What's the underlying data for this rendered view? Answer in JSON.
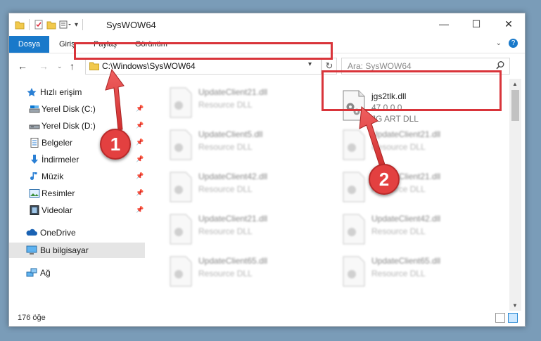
{
  "window": {
    "title": "SysWOW64",
    "minimize": "—",
    "maximize": "☐",
    "close": "✕"
  },
  "ribbon": {
    "tabs": [
      "Dosya",
      "Giriş",
      "Paylaş",
      "Görünüm"
    ],
    "accent": "#1979ca"
  },
  "nav": {
    "back": "←",
    "forward": "→",
    "up": "↑",
    "address": "C:\\Windows\\SysWOW64",
    "search_placeholder": "Ara: SysWOW64"
  },
  "sidebar": {
    "quick_access": "Hızlı erişim",
    "items": [
      {
        "label": "Yerel Disk (C:)",
        "icon": "drive-icon"
      },
      {
        "label": "Yerel Disk (D:)",
        "icon": "drive-icon"
      },
      {
        "label": "Belgeler",
        "icon": "documents-icon"
      },
      {
        "label": "İndirmeler",
        "icon": "download-icon"
      },
      {
        "label": "Müzik",
        "icon": "music-icon"
      },
      {
        "label": "Resimler",
        "icon": "pictures-icon"
      },
      {
        "label": "Videolar",
        "icon": "videos-icon"
      }
    ],
    "onedrive": "OneDrive",
    "this_pc": "Bu bilgisayar",
    "network": "Ağ"
  },
  "files": {
    "highlighted": {
      "name": "jgs2tlk.dll",
      "version": "47.0.0.0",
      "description": "JG ART DLL"
    },
    "left_column": [
      {
        "name": "UpdateClient21.dll",
        "desc": "Resource DLL"
      },
      {
        "name": "UpdateClient5.dll",
        "desc": "Resource DLL"
      },
      {
        "name": "UpdateClient42.dll",
        "desc": "Resource DLL"
      },
      {
        "name": "UpdateClient21.dll",
        "desc": "Resource DLL"
      },
      {
        "name": "UpdateClient65.dll",
        "desc": "Resource DLL"
      }
    ],
    "right_column": [
      {
        "name": "UpdateClient21.dll",
        "desc": "Resource DLL"
      },
      {
        "name": "UpdateClient21.dll",
        "desc": "Resource DLL"
      },
      {
        "name": "UpdateClient42.dll",
        "desc": "Resource DLL"
      },
      {
        "name": "UpdateClient65.dll",
        "desc": "Resource DLL"
      }
    ]
  },
  "status": {
    "item_count": "176 öğe"
  },
  "annotations": {
    "step1": "1",
    "step2": "2",
    "color": "#e34040"
  }
}
